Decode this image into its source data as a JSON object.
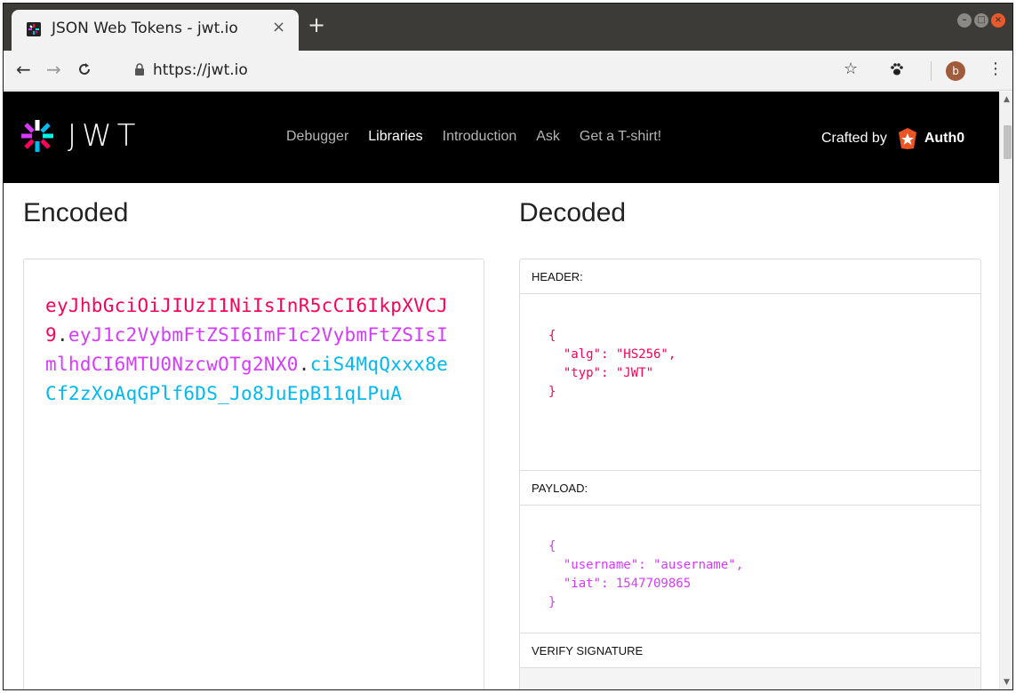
{
  "browser": {
    "tab_title": "JSON Web Tokens - jwt.io",
    "tab_close": "×",
    "new_tab": "+",
    "url": "https://jwt.io",
    "avatar_letter": "b",
    "icons": {
      "back": "arrow-left-icon",
      "forward": "arrow-right-icon",
      "reload": "reload-icon",
      "lock": "lock-icon",
      "star": "star-icon",
      "extension": "paw-extension-icon",
      "menu": "kebab-menu-icon"
    }
  },
  "nav": {
    "logo_text": "JWT",
    "links": [
      {
        "label": "Debugger",
        "active": false
      },
      {
        "label": "Libraries",
        "active": true
      },
      {
        "label": "Introduction",
        "active": false
      },
      {
        "label": "Ask",
        "active": false
      },
      {
        "label": "Get a T-shirt!",
        "active": false
      }
    ],
    "crafted_by": "Crafted by",
    "brand": "Auth0"
  },
  "encoded": {
    "heading": "Encoded",
    "header_part": "eyJhbGciOiJIUzI1NiIsInR5cCI6IkpXVCJ9",
    "payload_part": "eyJ1c2VybmFtZSI6ImF1c2VybmFtZSIsImlhdCI6MTU0NzcwOTg2NX0",
    "signature_part": "ciS4MqQxxx8eCf2zXoAqGPlf6DS_Jo8JuEpB11qLPuA",
    "dot": "."
  },
  "decoded": {
    "heading": "Decoded",
    "header_label": "HEADER:",
    "header_json": "{\n  \"alg\": \"HS256\",\n  \"typ\": \"JWT\"\n}",
    "payload_label": "PAYLOAD:",
    "payload_json": "{\n  \"username\": \"ausername\",\n  \"iat\": 1547709865\n}",
    "verify_label": "VERIFY SIGNATURE"
  },
  "colors": {
    "header": "#fb015b",
    "payload": "#d63aff",
    "signature": "#00b9f1",
    "nav_bg": "#000000"
  }
}
